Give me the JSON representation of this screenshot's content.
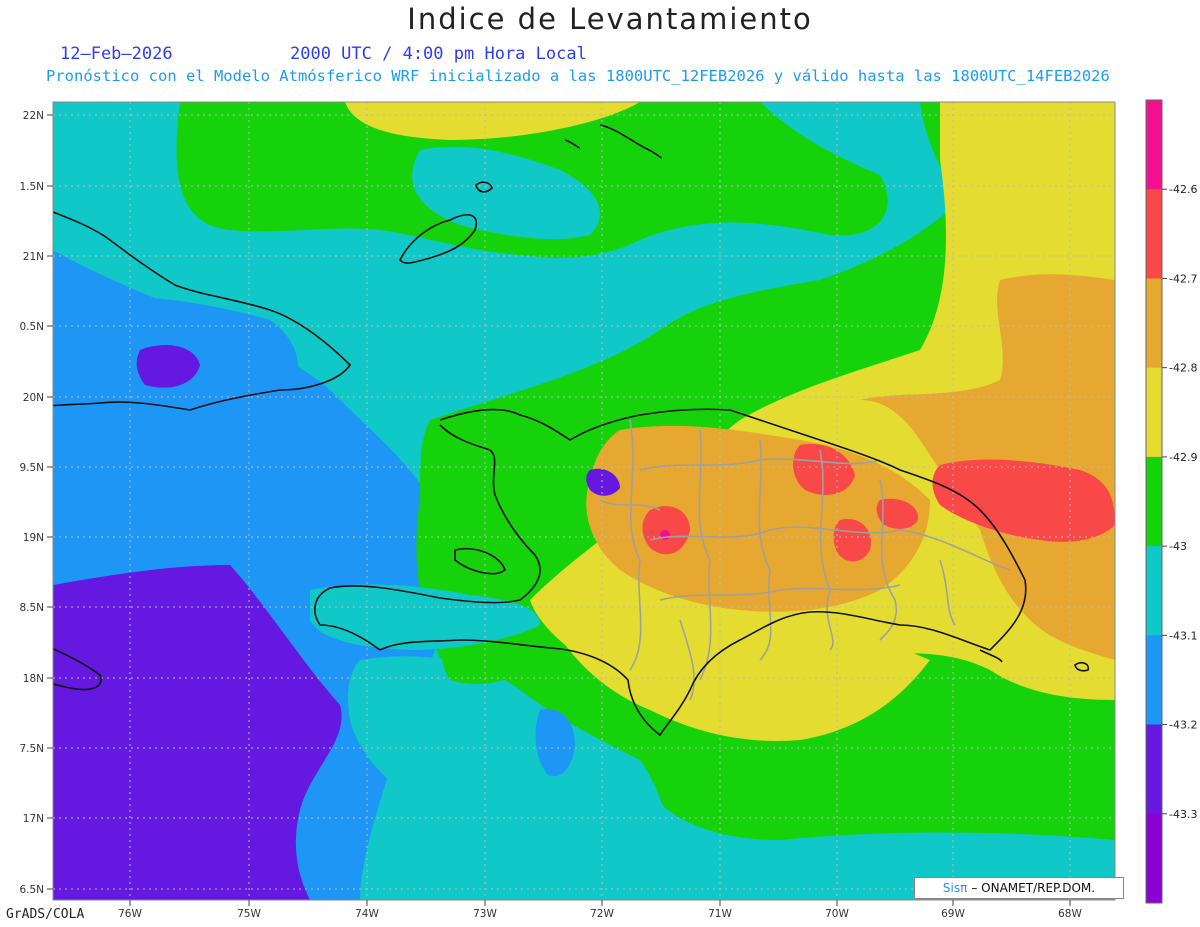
{
  "header": {
    "title": "Indice de Levantamiento",
    "date": "12–Feb–2026",
    "time": "2000 UTC / 4:00 pm Hora Local",
    "description": "Pronóstico con el Modelo Atmósferico WRF inicializado a las 1800UTC_12FEB2026 y válido hasta las  1800UTC_14FEB2026"
  },
  "map": {
    "lat_labels": [
      "22N",
      "1.5N",
      "21N",
      "0.5N",
      "20N",
      "9.5N",
      "19N",
      "8.5N",
      "18N",
      "7.5N",
      "17N",
      "6.5N"
    ],
    "lon_labels": [
      "76W",
      "75W",
      "74W",
      "73W",
      "72W",
      "71W",
      "70W",
      "69W",
      "68W"
    ],
    "coastline_color": "#111111",
    "province_border_color": "#a0a0a0",
    "gridline_color": "#bbbbbb"
  },
  "colorbar": {
    "labels": [
      "-42.6",
      "-42.7",
      "-42.8",
      "-42.9",
      "-43",
      "-43.1",
      "-43.2",
      "-43.3"
    ],
    "colors": [
      "#f01090",
      "#f84848",
      "#e6a830",
      "#e4dc30",
      "#16d20a",
      "#10c8c8",
      "#1e96f6",
      "#6418e0",
      "#8c00d6"
    ]
  },
  "footer": {
    "software": "GrADS/COLA",
    "credit_brand": "Sisπ",
    "credit_text": "– ONAMET/REP.DOM."
  }
}
